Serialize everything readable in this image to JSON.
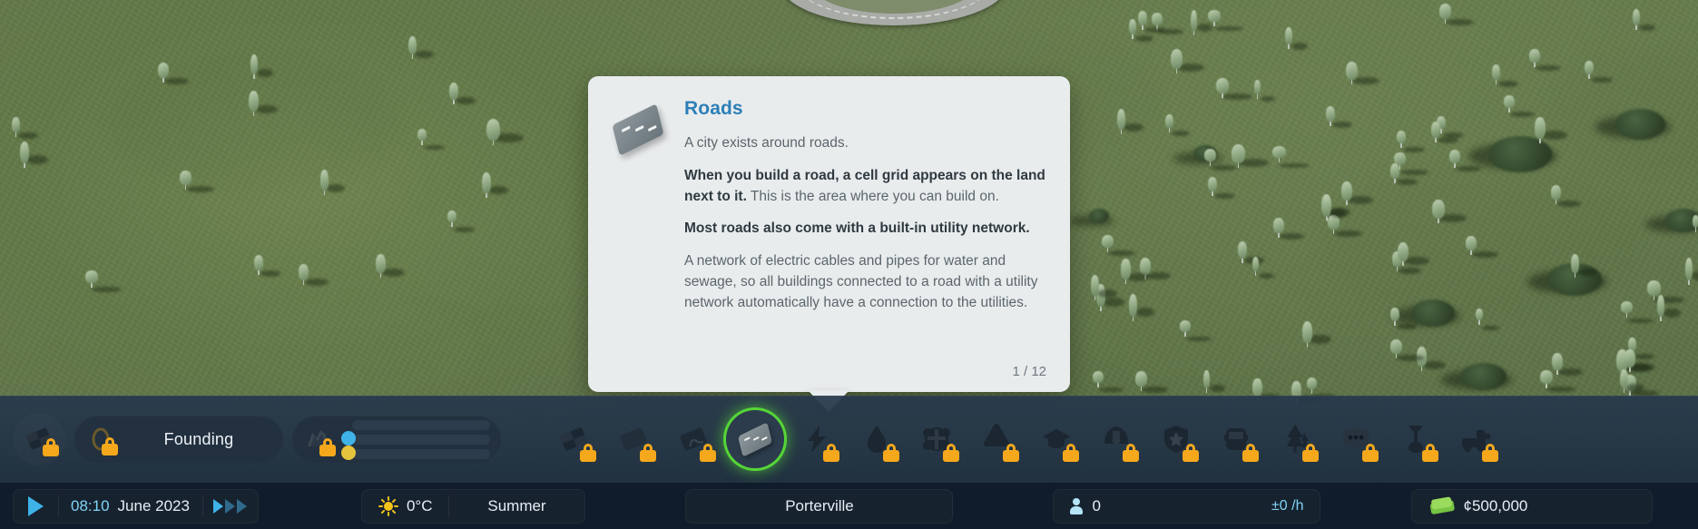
{
  "tooltip": {
    "title": "Roads",
    "icon": "road-tile-icon",
    "paragraphs": [
      {
        "style": "normal",
        "text": "A city exists around roads."
      },
      {
        "style": "mixed",
        "lead": "When you build a road, a cell grid appears on the land next to it.",
        "rest": " This is the area where you can build on."
      },
      {
        "style": "strong",
        "text": "Most roads also come with a built-in utility network."
      },
      {
        "style": "normal",
        "text": "A network of electric cables and pipes for water and sewage, so all buildings connected to a road with a utility network automatically have a connection to the utilities."
      }
    ],
    "pager": "1 / 12",
    "title_color": "#2d7fb8"
  },
  "toolbar": {
    "milestone_label": "Founding",
    "milestone_icon": "milestone-coin-icon",
    "progression_icon": "progression-hand-icon",
    "left_ghost_icon": "grid-tile-icon",
    "lock_color": "#f5a81c",
    "selected_ring_color": "#55d537",
    "progress_dots": [
      "#3fb3e8",
      "#e6c33c"
    ],
    "tools": [
      {
        "name": "roads",
        "icon": "road-tile-icon",
        "locked": false,
        "selected": true
      },
      {
        "name": "electricity",
        "icon": "lightning-bolt-icon",
        "locked": true,
        "selected": false
      },
      {
        "name": "water-and-sewage",
        "icon": "water-drop-icon",
        "locked": true,
        "selected": false
      },
      {
        "name": "health-and-deathcare",
        "icon": "health-cross-icon",
        "locked": true,
        "selected": false
      },
      {
        "name": "garbage-management",
        "icon": "recycle-icon",
        "locked": true,
        "selected": false
      },
      {
        "name": "education",
        "icon": "graduation-cap-icon",
        "locked": true,
        "selected": false
      },
      {
        "name": "fire-and-rescue",
        "icon": "fire-helmet-icon",
        "locked": true,
        "selected": false
      },
      {
        "name": "police",
        "icon": "police-badge-icon",
        "locked": true,
        "selected": false
      },
      {
        "name": "transportation",
        "icon": "bus-icon",
        "locked": true,
        "selected": false
      },
      {
        "name": "parks-and-recreation",
        "icon": "tree-icon",
        "locked": true,
        "selected": false
      },
      {
        "name": "communications",
        "icon": "speech-bubble-icon",
        "locked": true,
        "selected": false
      },
      {
        "name": "landscaping",
        "icon": "shovel-icon",
        "locked": true,
        "selected": false
      },
      {
        "name": "roads-services",
        "icon": "maintenance-truck-icon",
        "locked": true,
        "selected": false
      }
    ],
    "tools_left_locked": [
      {
        "name": "zones",
        "icon": "zone-grid-icon",
        "locked": true
      },
      {
        "name": "areas",
        "icon": "area-tile-icon",
        "locked": true
      },
      {
        "name": "signature-buildings",
        "icon": "signature-building-icon",
        "locked": true
      }
    ]
  },
  "statusbar": {
    "play_icon": "play-icon",
    "time": "08:10",
    "date": "June 2023",
    "fastforward_icon": "fast-forward-icon",
    "weather_icon": "sun-icon",
    "temperature": "0°C",
    "season": "Summer",
    "city_name": "Porterville",
    "population_icon": "person-icon",
    "population": "0",
    "population_rate": "±0 /h",
    "money_icon": "money-icon",
    "money": "¢500,000",
    "accent_cyan": "#7fd4f5"
  }
}
